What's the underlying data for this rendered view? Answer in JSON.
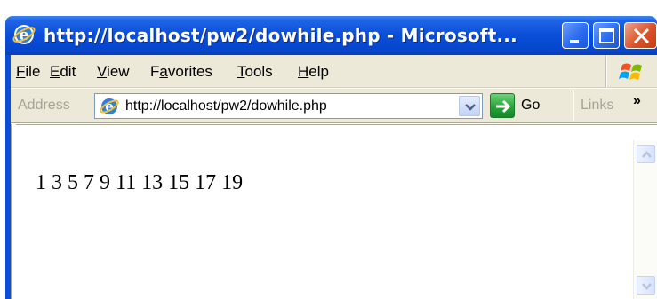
{
  "window": {
    "title": "http://localhost/pw2/dowhile.php - Microsoft...",
    "title_icon": "ie-icon",
    "controls": [
      "minimize-icon",
      "maximize-icon",
      "close-icon"
    ]
  },
  "menu": {
    "file": {
      "key": "F",
      "rest": "ile"
    },
    "edit": {
      "key": "E",
      "rest": "dit"
    },
    "view": {
      "key": "V",
      "rest": "iew"
    },
    "favorites": {
      "pre": "F",
      "key": "a",
      "rest": "vorites"
    },
    "tools": {
      "key": "T",
      "rest": "ools"
    },
    "help": {
      "key": "H",
      "rest": "elp"
    },
    "logo_icon": "windows-flag-icon"
  },
  "address_bar": {
    "label": "Address",
    "url": "http://localhost/pw2/dowhile.php",
    "go_label": "Go",
    "links_label": "Links",
    "links_more": "»"
  },
  "content": {
    "output": "1 3 5 7 9 11 13 15 17 19"
  },
  "colors": {
    "titlebar": "#0a4ed8",
    "chrome": "#ece9d8",
    "go_button": "#23a437",
    "close_button": "#d9542b"
  }
}
